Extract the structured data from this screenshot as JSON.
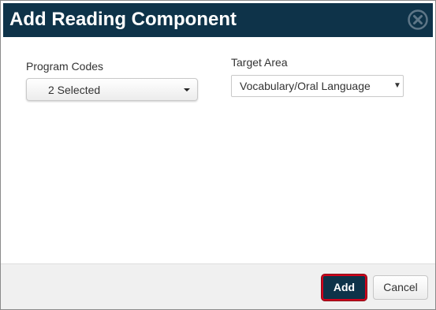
{
  "dialog": {
    "title": "Add Reading Component",
    "close_icon": "close-circle-icon"
  },
  "form": {
    "program_codes": {
      "label": "Program Codes",
      "value": "2 Selected",
      "icon": "caret-down-icon"
    },
    "target_area": {
      "label": "Target Area",
      "value": "Vocabulary/Oral Language",
      "icon": "dropdown-arrow-icon"
    }
  },
  "footer": {
    "add_label": "Add",
    "cancel_label": "Cancel"
  },
  "colors": {
    "titlebar": "#0e3349",
    "primary_button": "#0e3349",
    "focus_outline": "#d0021b",
    "footer_background": "#f0f0f0"
  }
}
